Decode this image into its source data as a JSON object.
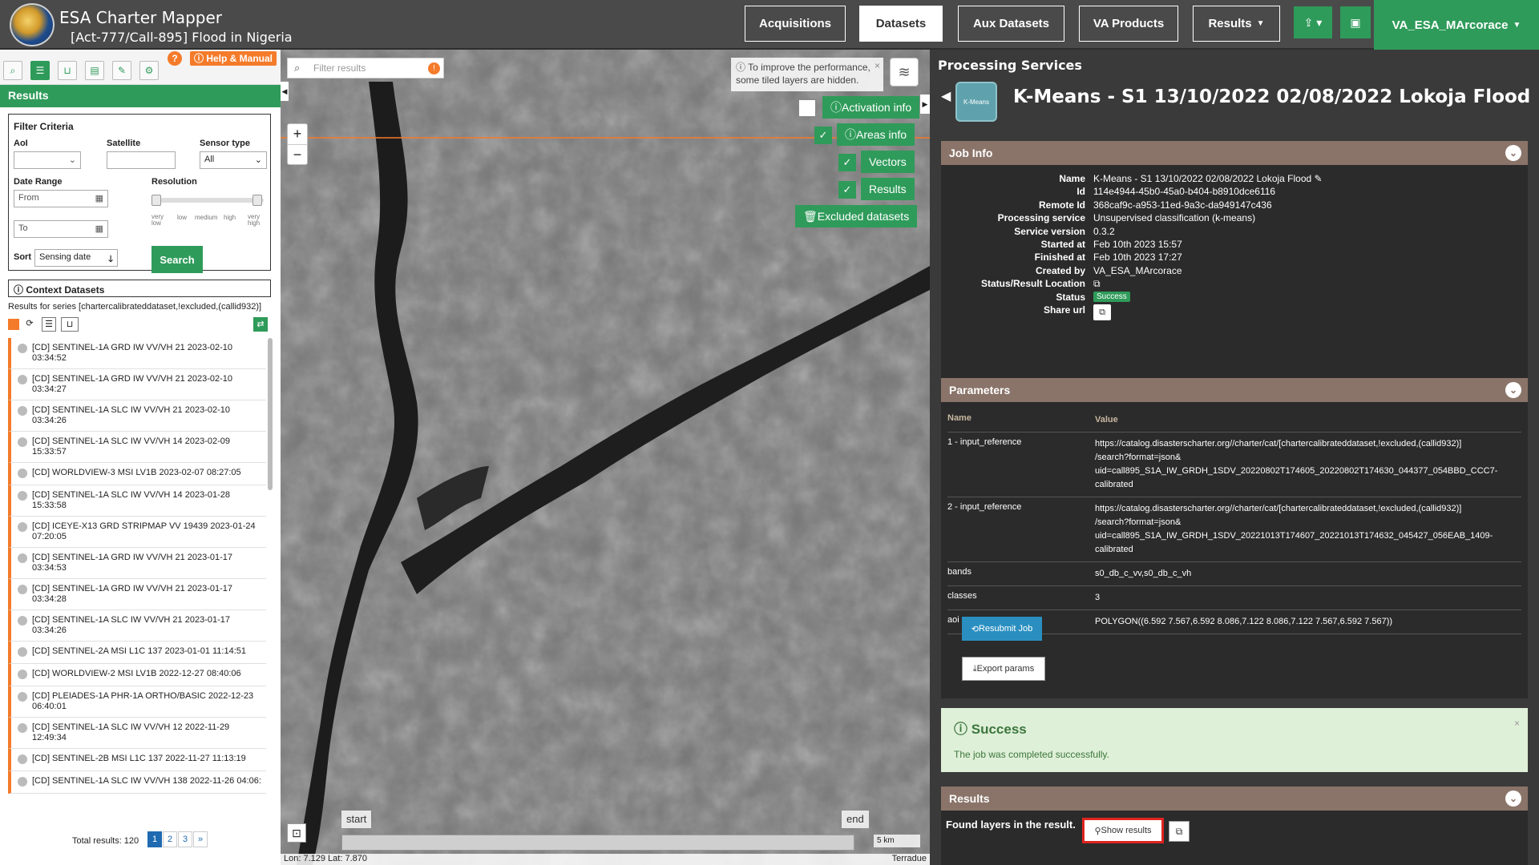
{
  "header": {
    "app_title": "ESA Charter Mapper",
    "activation": "[Act-777/Call-895] Flood in Nigeria",
    "nav": [
      "Acquisitions",
      "Datasets",
      "Aux Datasets",
      "VA Products",
      "Results"
    ],
    "active_tab": "Datasets",
    "user": "VA_ESA_MArcorace"
  },
  "left": {
    "help_label": "Help & Manual",
    "panel_title": "Results",
    "filter": {
      "title": "Filter Criteria",
      "aoi_label": "AoI",
      "satellite_label": "Satellite",
      "sensor_label": "Sensor type",
      "sensor_value": "All",
      "date_label": "Date Range",
      "from_placeholder": "From",
      "to_placeholder": "To",
      "resolution_label": "Resolution",
      "resolution_ticks": [
        "very low",
        "low",
        "medium",
        "high",
        "very high"
      ],
      "sort_label": "Sort",
      "sort_value": "Sensing date",
      "search_label": "Search"
    },
    "context_title": "Context Datasets",
    "series_text": "Results for series [chartercalibrateddataset,!excluded,(callid932)]",
    "items": [
      "[CD] SENTINEL-1A GRD IW VV/VH 21 2023-02-10 03:34:52",
      "[CD] SENTINEL-1A GRD IW VV/VH 21 2023-02-10 03:34:27",
      "[CD] SENTINEL-1A SLC IW VV/VH 21 2023-02-10 03:34:26",
      "[CD] SENTINEL-1A SLC IW VV/VH 14 2023-02-09 15:33:57",
      "[CD] WORLDVIEW-3 MSI LV1B 2023-02-07 08:27:05",
      "[CD] SENTINEL-1A SLC IW VV/VH 14 2023-01-28 15:33:58",
      "[CD] ICEYE-X13 GRD STRIPMAP VV 19439 2023-01-24 07:20:05",
      "[CD] SENTINEL-1A GRD IW VV/VH 21 2023-01-17 03:34:53",
      "[CD] SENTINEL-1A GRD IW VV/VH 21 2023-01-17 03:34:28",
      "[CD] SENTINEL-1A SLC IW VV/VH 21 2023-01-17 03:34:26",
      "[CD] SENTINEL-2A MSI L1C 137 2023-01-01 11:14:51",
      "[CD] WORLDVIEW-2 MSI LV1B 2022-12-27 08:40:06",
      "[CD] PLEIADES-1A PHR-1A ORTHO/BASIC 2022-12-23 06:40:01",
      "[CD] SENTINEL-1A SLC IW VV/VH 12 2022-11-29 12:49:34",
      "[CD] SENTINEL-2B MSI L1C 137 2022-11-27 11:13:19",
      "[CD] SENTINEL-1A SLC IW VV/VH 138 2022-11-26 04:06:"
    ],
    "total": "Total results: 120",
    "pages": [
      "1",
      "2",
      "3",
      "»"
    ]
  },
  "map": {
    "filter_placeholder": "Filter results",
    "perf_msg": "To improve the performance, some tiled layers are hidden.",
    "layers": [
      "Activation info",
      "Areas info",
      "Vectors",
      "Results",
      "Excluded datasets"
    ],
    "timeline_start": "start",
    "timeline_end": "end",
    "scale": "5 km",
    "coords": "Lon: 7.129 Lat: 7.870",
    "attribution": "Terradue"
  },
  "right": {
    "section_title": "Processing Services",
    "icon_label": "K-Means",
    "job_title": "K-Means - S1 13/10/2022 02/08/2022 Lokoja Flood",
    "jobinfo_title": "Job Info",
    "jobinfo": [
      {
        "k": "Name",
        "v": "K-Means - S1 13/10/2022 02/08/2022 Lokoja Flood ✎"
      },
      {
        "k": "Id",
        "v": "114e4944-45b0-45a0-b404-b8910dce6116"
      },
      {
        "k": "Remote Id",
        "v": "368caf9c-a953-11ed-9a3c-da949147c436"
      },
      {
        "k": "Processing service",
        "v": "Unsupervised classification (k-means)"
      },
      {
        "k": "Service version",
        "v": "0.3.2"
      },
      {
        "k": "Started at",
        "v": "Feb 10th 2023 15:57"
      },
      {
        "k": "Finished at",
        "v": "Feb 10th 2023 17:27"
      },
      {
        "k": "Created by",
        "v": "VA_ESA_MArcorace"
      },
      {
        "k": "Status/Result Location",
        "v": ""
      },
      {
        "k": "Status",
        "v": ""
      },
      {
        "k": "Share url",
        "v": ""
      }
    ],
    "status_badge": "Success",
    "params_title": "Parameters",
    "param_headers": [
      "Name",
      "Value"
    ],
    "params": [
      {
        "n": "1 - input_reference",
        "v": [
          "https://catalog.disasterscharter.org//charter/cat/[chartercalibrateddataset,!excluded,(callid932)]",
          "/search?format=json&",
          "uid=call895_S1A_IW_GRDH_1SDV_20220802T174605_20220802T174630_044377_054BBD_CCC7-calibrated"
        ]
      },
      {
        "n": "2 - input_reference",
        "v": [
          "https://catalog.disasterscharter.org//charter/cat/[chartercalibrateddataset,!excluded,(callid932)]",
          "/search?format=json&",
          "uid=call895_S1A_IW_GRDH_1SDV_20221013T174607_20221013T174632_045427_056EAB_1409-calibrated"
        ]
      },
      {
        "n": "bands",
        "v": [
          "s0_db_c_vv,s0_db_c_vh"
        ]
      },
      {
        "n": "classes",
        "v": [
          "3"
        ]
      },
      {
        "n": "aoi",
        "v": [
          "POLYGON((6.592 7.567,6.592 8.086,7.122 8.086,7.122 7.567,6.592 7.567))"
        ]
      }
    ],
    "resubmit_label": "Resubmit Job",
    "export_label": "Export params",
    "success_title": "Success",
    "success_msg": "The job was completed successfully.",
    "results_title": "Results",
    "results_text": "Found layers in the result.",
    "show_results": "Show results"
  }
}
